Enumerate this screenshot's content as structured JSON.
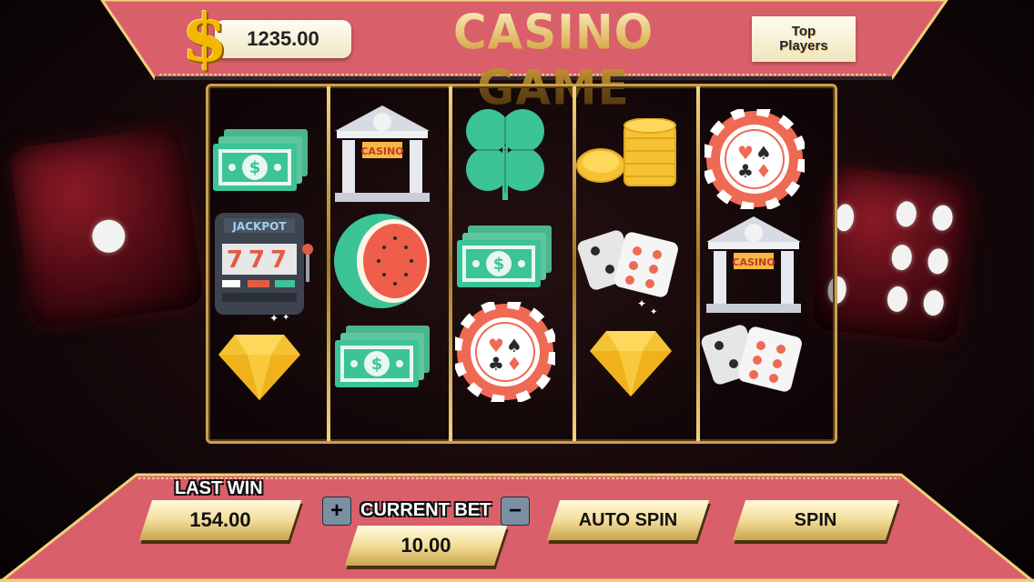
{
  "header": {
    "balance": "1235.00",
    "currency_symbol": "$",
    "title": "CASINO GAME",
    "top_players_label_1": "Top",
    "top_players_label_2": "Players"
  },
  "reels": [
    [
      "cash-stack-icon",
      "jackpot-slot-machine-icon",
      "diamond-icon"
    ],
    [
      "casino-building-icon",
      "watermelon-icon",
      "cash-stack-icon"
    ],
    [
      "clover-icon",
      "cash-stack-icon",
      "poker-chip-icon"
    ],
    [
      "gold-coins-icon",
      "dice-pair-icon",
      "diamond-icon"
    ],
    [
      "poker-chip-icon",
      "casino-building-icon",
      "dice-pair-icon"
    ]
  ],
  "symbol_text": {
    "casino_sign": "CASINO",
    "jackpot": "JACKPOT",
    "sevens": "777"
  },
  "footer": {
    "last_win_label": "LAST WIN",
    "last_win_value": "154.00",
    "current_bet_label": "CURRENT BET",
    "current_bet_value": "10.00",
    "plus": "+",
    "minus": "−",
    "auto_spin": "AUTO SPIN",
    "spin": "SPIN"
  },
  "colors": {
    "panel_pink": "#d9606a",
    "gold": "#c9a04c",
    "teal": "#3cc397",
    "chip_red": "#ef6a54"
  }
}
